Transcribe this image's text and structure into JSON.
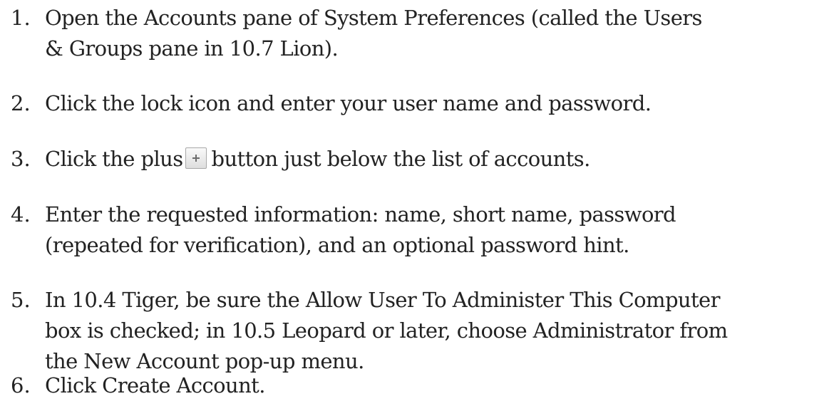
{
  "steps": [
    {
      "num": "1.",
      "lines": [
        "Open the Accounts pane of System Preferences (called the Users",
        "& Groups pane in 10.7 Lion)."
      ]
    },
    {
      "num": "2.",
      "lines": [
        "Click the lock icon and enter your user name and password."
      ]
    },
    {
      "num": "3.",
      "before": "Click the plus",
      "after": "button just below the list of accounts.",
      "icon": "plus-button-icon"
    },
    {
      "num": "4.",
      "lines": [
        "Enter the requested information: name, short name, password",
        "(repeated for verification), and an optional password hint."
      ]
    },
    {
      "num": "5.",
      "lines": [
        "In 10.4 Tiger, be sure the Allow User To Administer This Computer",
        "box is checked; in 10.5 Leopard or later, choose Administrator from",
        "the New Account pop-up menu."
      ]
    },
    {
      "num": "6.",
      "lines": [
        "Click Create Account."
      ]
    }
  ]
}
